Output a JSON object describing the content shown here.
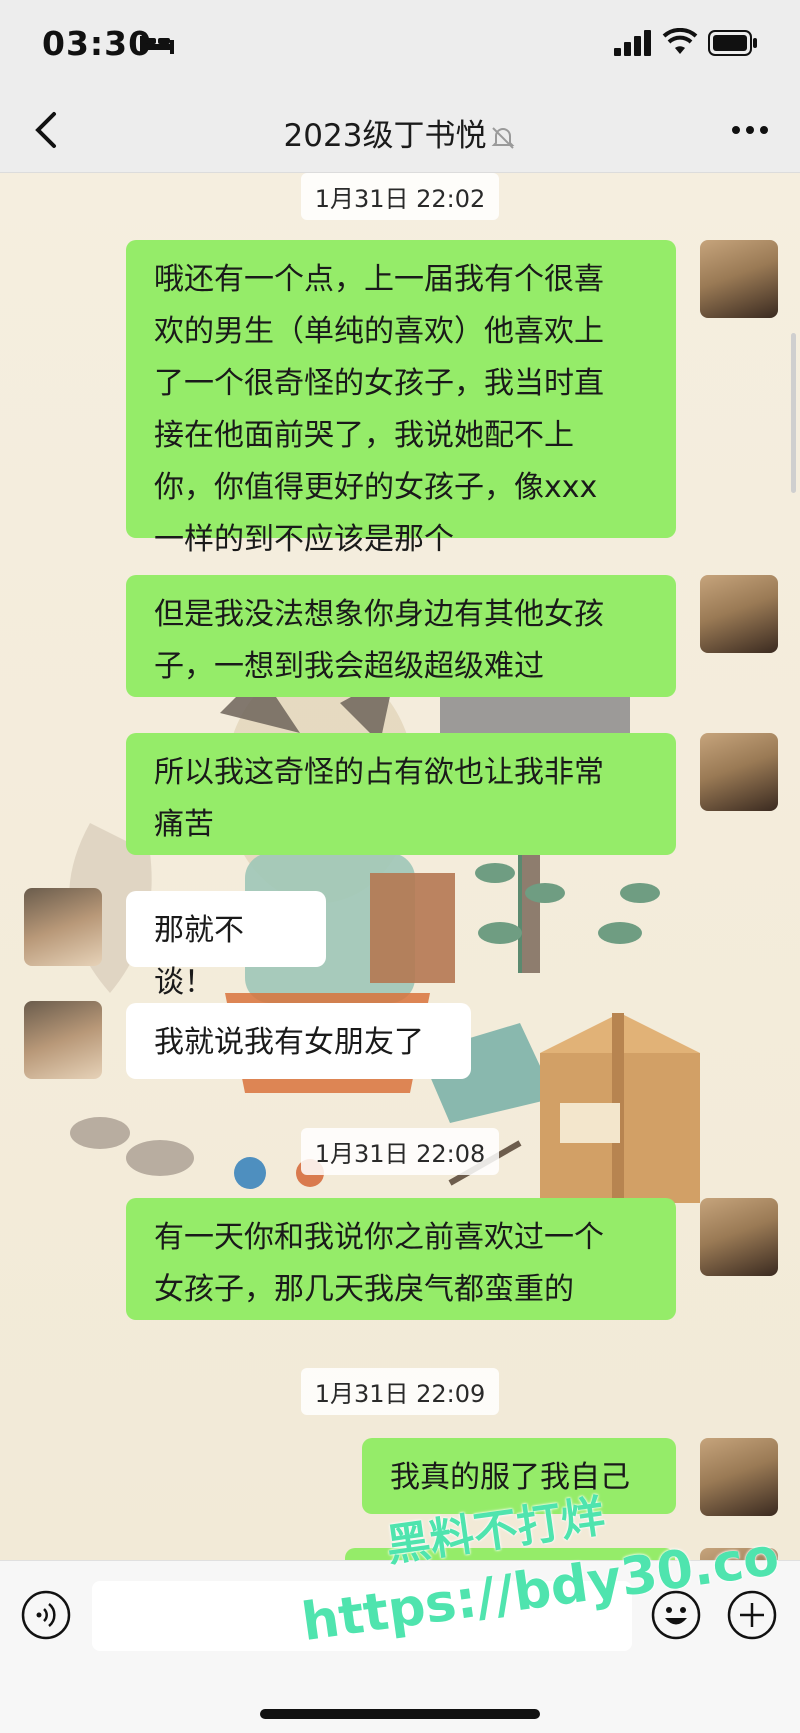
{
  "status": {
    "time": "03:30"
  },
  "header": {
    "title": "2023级丁书悦"
  },
  "timestamps": [
    "1月31日 22:02",
    "1月31日 22:08",
    "1月31日 22:09"
  ],
  "messages": [
    {
      "side": "right",
      "lines": [
        "哦还有一个点，上一届我有个很喜",
        "欢的男生（单纯的喜欢）他喜欢上",
        "了一个很奇怪的女孩子，我当时直",
        "接在他面前哭了，我说她配不上",
        "你，你值得更好的女孩子，像xxx",
        "一样的到不应该是那个"
      ]
    },
    {
      "side": "right",
      "lines": [
        "但是我没法想象你身边有其他女孩",
        "子，一想到我会超级超级难过"
      ]
    },
    {
      "side": "right",
      "lines": [
        "所以我这奇怪的占有欲也让我非常",
        "痛苦"
      ]
    },
    {
      "side": "left",
      "lines": [
        "那就不谈！"
      ]
    },
    {
      "side": "left",
      "lines": [
        "我就说我有女朋友了"
      ]
    },
    {
      "side": "right",
      "lines": [
        "有一天你和我说你之前喜欢过一个",
        "女孩子，那几天我戾气都蛮重的"
      ]
    },
    {
      "side": "right",
      "lines": [
        "我真的服了我自己"
      ]
    }
  ],
  "watermark": {
    "line1": "黑料不打烊",
    "line2": "https://bdy30.co"
  },
  "colors": {
    "bubble_right": "#95ec69",
    "bubble_left": "#ffffff",
    "bar_bg": "#ededed"
  },
  "icons": [
    "back-arrow-icon",
    "mute-bell-icon",
    "more-dots-icon",
    "voice-icon",
    "emoji-icon",
    "plus-icon"
  ]
}
